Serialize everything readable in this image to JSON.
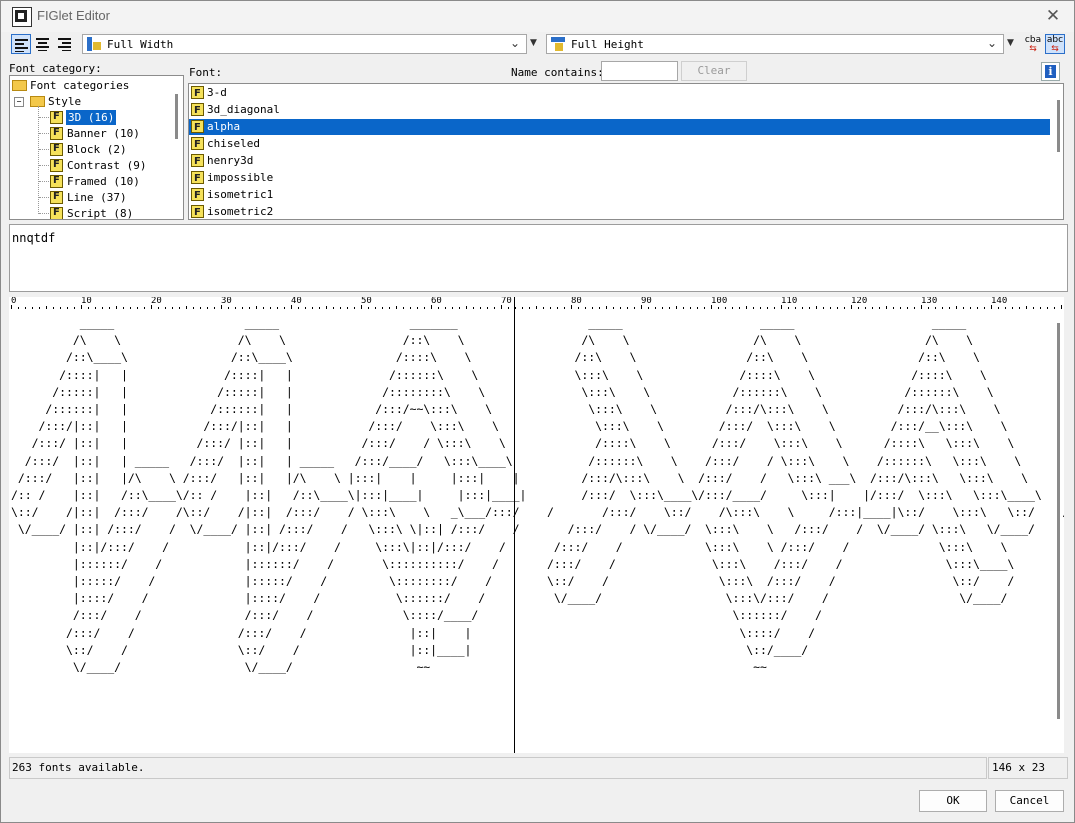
{
  "window": {
    "title": "FIGlet Editor",
    "close_label": "✕"
  },
  "toolbar": {
    "width_mode": "Full Width",
    "height_mode": "Full Height",
    "reverse_icon_text": "cba",
    "reverse_icon_text2": "abc",
    "info_label": "i"
  },
  "category_panel": {
    "label": "Font category:",
    "root": "Font categories",
    "group": "Style",
    "items": [
      {
        "label": "3D (16)",
        "selected": true
      },
      {
        "label": "Banner (10)",
        "selected": false
      },
      {
        "label": "Block (2)",
        "selected": false
      },
      {
        "label": "Contrast (9)",
        "selected": false
      },
      {
        "label": "Framed (10)",
        "selected": false
      },
      {
        "label": "Line (37)",
        "selected": false
      },
      {
        "label": "Script (8)",
        "selected": false
      }
    ]
  },
  "font_panel": {
    "label": "Font:",
    "name_contains_label": "Name contains:",
    "name_contains_value": "",
    "clear_label": "Clear",
    "fonts": [
      {
        "name": "3-d",
        "selected": false
      },
      {
        "name": "3d_diagonal",
        "selected": false
      },
      {
        "name": "alpha",
        "selected": true
      },
      {
        "name": "chiseled",
        "selected": false
      },
      {
        "name": "henry3d",
        "selected": false
      },
      {
        "name": "impossible",
        "selected": false
      },
      {
        "name": "isometric1",
        "selected": false
      },
      {
        "name": "isometric2",
        "selected": false
      }
    ]
  },
  "input_text": "nnqtdf",
  "ruler": {
    "labels": [
      "0",
      "10",
      "20",
      "30",
      "40",
      "50",
      "60",
      "70",
      "80",
      "90",
      "100",
      "110",
      "120",
      "130",
      "140"
    ],
    "marker": "70"
  },
  "preview_text": "          _____                   _____                   _______                   _____                    _____                    _____          \n         /\\    \\                 /\\    \\                 /::\\    \\                 /\\    \\                  /\\    \\                  /\\    \\         \n        /::\\____\\               /::\\____\\               /::::\\    \\               /::\\    \\                /::\\    \\                /::\\    \\        \n       /::::|   |              /::::|   |              /::::::\\    \\              \\:::\\    \\              /::::\\    \\              /::::\\    \\       \n      /:::::|   |             /:::::|   |             /::::::::\\    \\              \\:::\\    \\            /::::::\\    \\            /::::::\\    \\      \n     /::::::|   |            /::::::|   |            /:::/~~\\:::\\    \\              \\:::\\    \\          /:::/\\:::\\    \\          /:::/\\:::\\    \\     \n    /:::/|::|   |           /:::/|::|   |           /:::/    \\:::\\    \\              \\:::\\    \\        /:::/  \\:::\\    \\        /:::/__\\:::\\    \\    \n   /:::/ |::|   |          /:::/ |::|   |          /:::/    / \\:::\\    \\             /::::\\    \\      /:::/    \\:::\\    \\      /::::\\   \\:::\\    \\   \n  /:::/  |::|   | _____   /:::/  |::|   | _____   /:::/____/   \\:::\\____\\           /::::::\\    \\    /:::/    / \\:::\\    \\    /::::::\\   \\:::\\    \\  \n /:::/   |::|   |/\\    \\ /:::/   |::|   |/\\    \\ |:::|    |     |:::|    |         /:::/\\:::\\    \\  /:::/    /   \\:::\\ ___\\  /:::/\\:::\\   \\:::\\    \\ \n/:: /    |::|   /::\\____\\/:: /    |::|   /::\\____\\|:::|____|     |:::|____|        /:::/  \\:::\\____\\/:::/____/     \\:::|    |/:::/  \\:::\\   \\:::\\____\\\n\\::/    /|::|  /:::/    /\\::/    /|::|  /:::/    / \\:::\\    \\   _\\___/:::/    /       /:::/    \\::/    /\\:::\\    \\     /:::|____|\\::/    \\:::\\   \\::/    /\n \\/____/ |::| /:::/    /  \\/____/ |::| /:::/    /   \\:::\\ \\|::| /:::/    /       /:::/    / \\/____/  \\:::\\    \\   /:::/    /  \\/____/ \\:::\\   \\/____/ \n         |::|/:::/    /           |::|/:::/    /     \\:::\\|::|/:::/    /       /:::/    /            \\:::\\    \\ /:::/    /             \\:::\\    \\     \n         |::::::/    /            |::::::/    /       \\::::::::::/    /       /:::/    /              \\:::\\    /:::/    /               \\:::\\____\\    \n         |:::::/    /             |:::::/    /         \\::::::::/    /        \\::/    /                \\:::\\  /:::/    /                 \\::/    /    \n         |::::/    /              |::::/    /           \\::::::/    /          \\/____/                  \\:::\\/:::/    /                   \\/____/     \n         /:::/    /               /:::/    /             \\::::/____/                                     \\::::::/    /                                \n        /:::/    /               /:::/    /               |::|    |                                       \\::::/    /                                 \n        \\::/    /                \\::/    /                |::|____|                                        \\::/____/                                  \n         \\/____/                  \\/____/                  ~~                                               ~~                                        ",
  "status": {
    "fonts_available": "263 fonts available.",
    "dimensions": "146 x 23"
  },
  "buttons": {
    "ok": "OK",
    "cancel": "Cancel"
  }
}
